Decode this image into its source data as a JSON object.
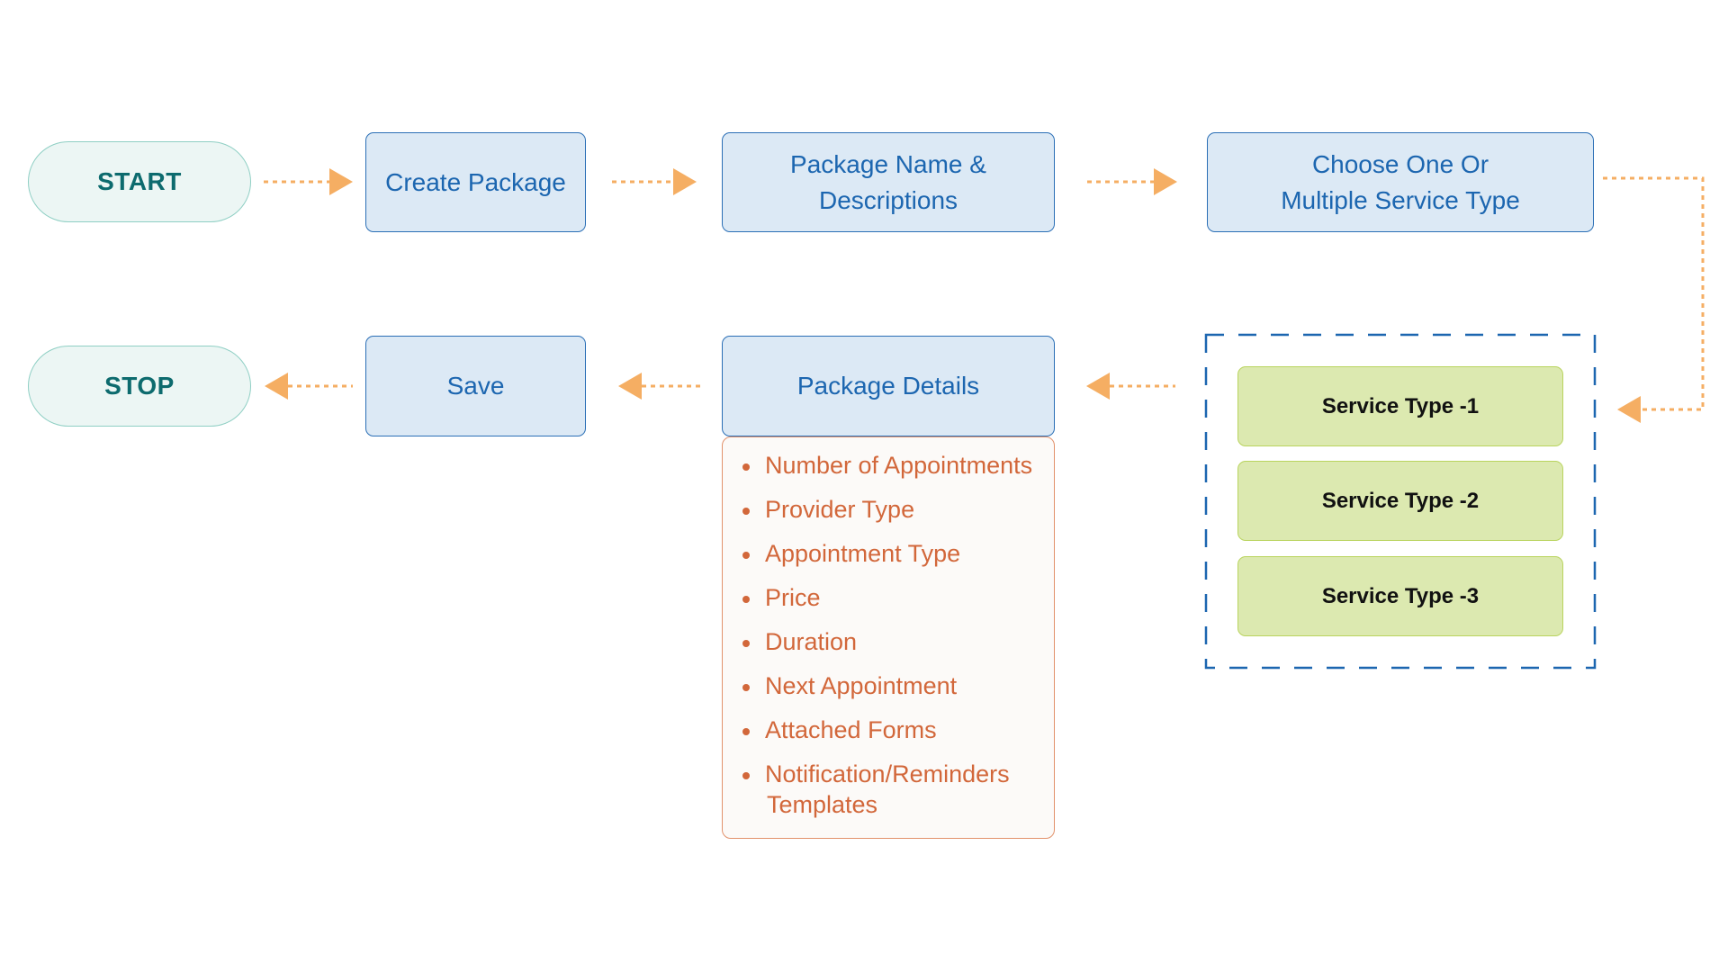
{
  "diagram": {
    "start_label": "START",
    "stop_label": "STOP",
    "steps": {
      "create_package": "Create Package",
      "package_name_line1": "Package Name &",
      "package_name_line2": "Descriptions",
      "choose_service_line1": "Choose One Or",
      "choose_service_line2": "Multiple Service Type",
      "package_details": "Package Details",
      "save": "Save"
    },
    "service_types": [
      "Service Type -1",
      "Service Type -2",
      "Service Type -3"
    ],
    "package_detail_items": [
      "Number of Appointments",
      "Provider Type",
      "Appointment Type",
      "Price",
      "Duration",
      "Next Appointment",
      "Attached Forms",
      "Notification/Reminders",
      "Templates"
    ],
    "colors": {
      "terminal_text": "#0d6b6e",
      "process_text": "#1c66b0",
      "arrow": "#f5ae63",
      "details_text": "#d2673a",
      "service_fill": "#dce9b0",
      "group_border": "#1c66b0"
    }
  }
}
